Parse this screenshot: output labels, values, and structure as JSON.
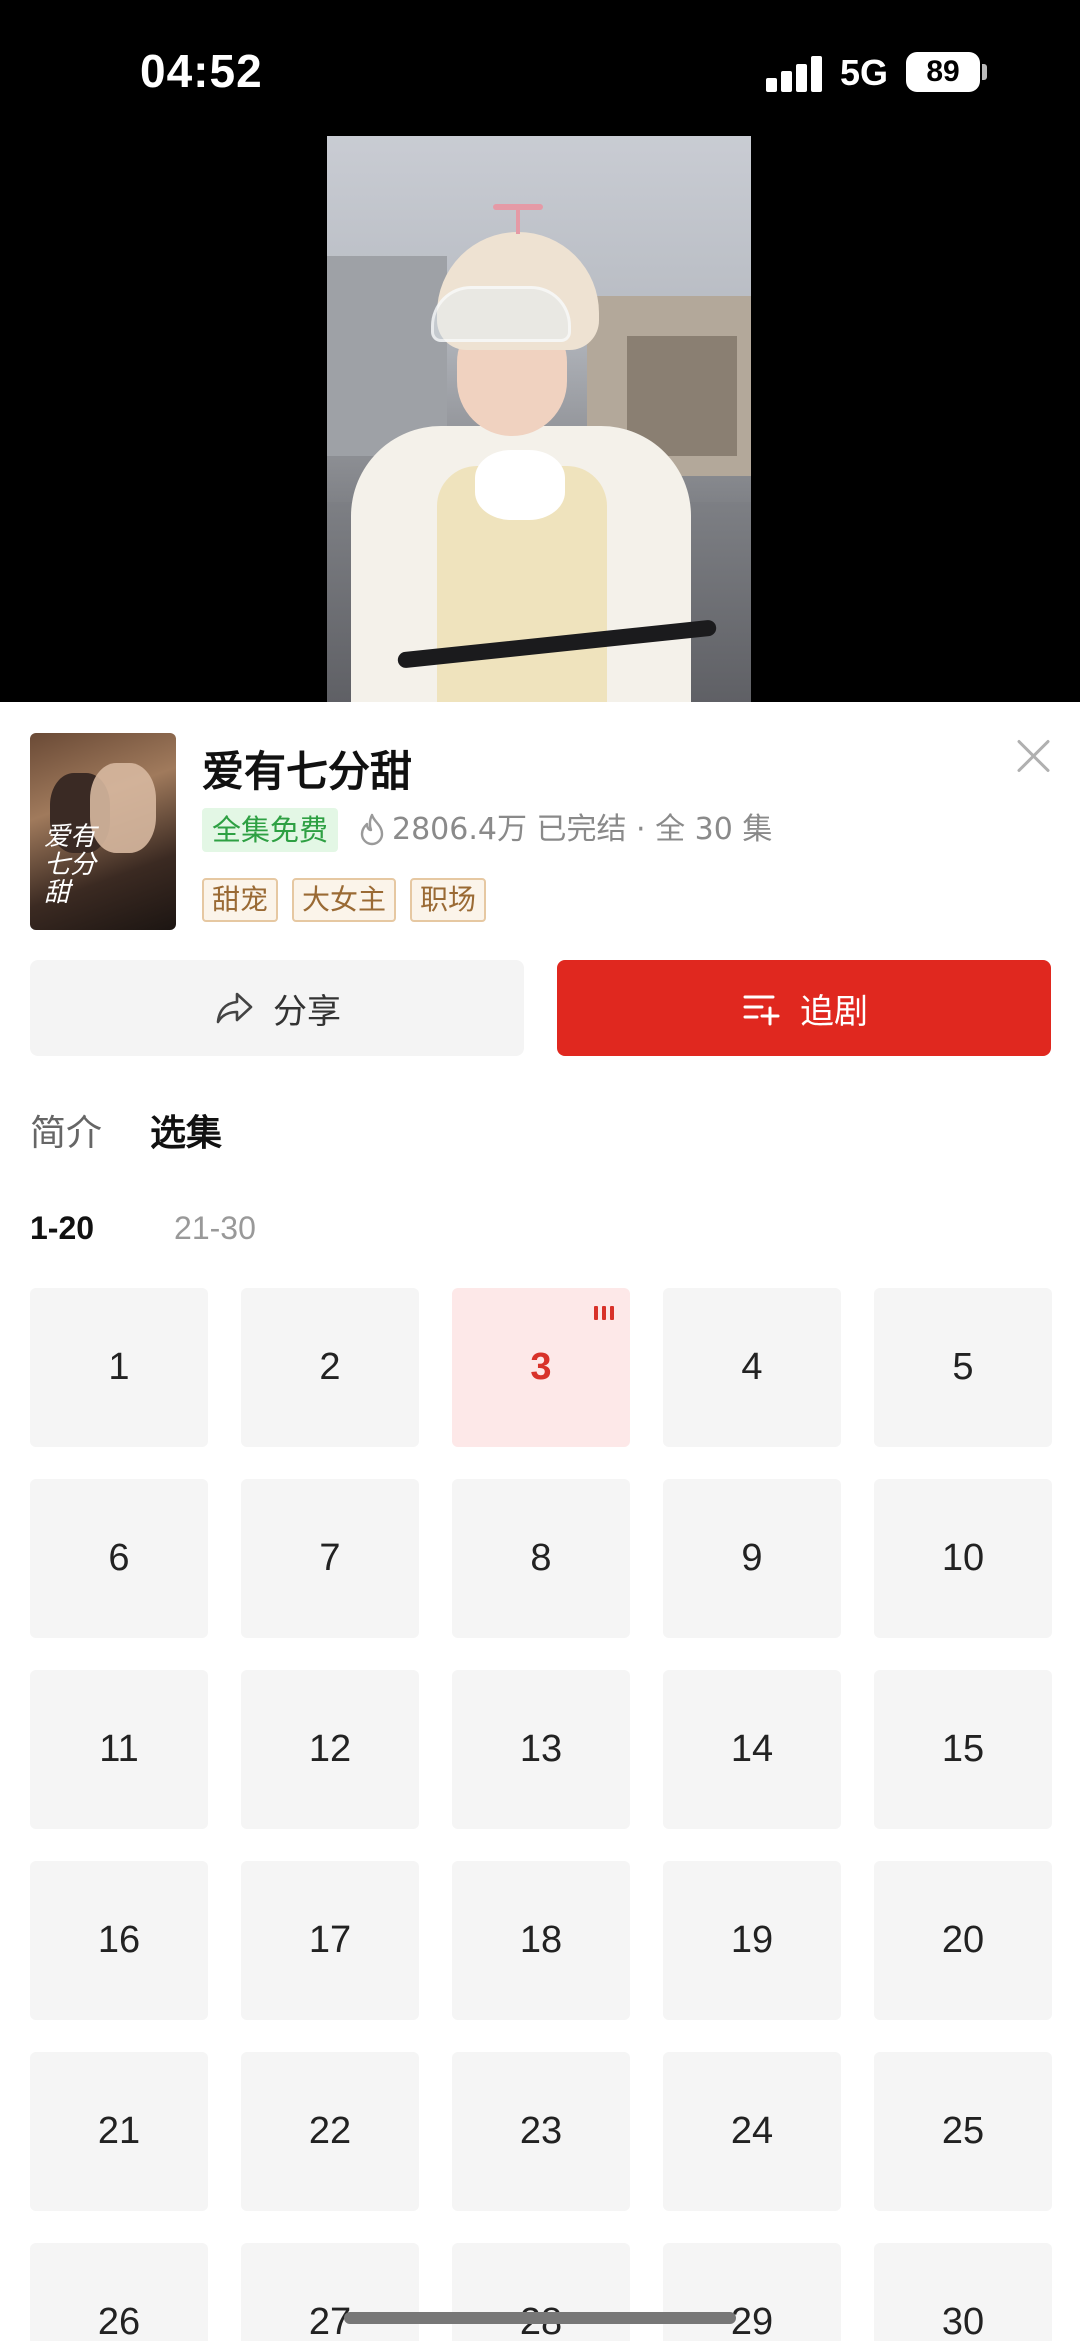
{
  "status_bar": {
    "time": "04:52",
    "network": "5G",
    "battery": "89"
  },
  "drama": {
    "title": "爱有七分甜",
    "poster_text": "爱有七分甜",
    "free_badge": "全集免费",
    "meta": "2806.4万 已完结 · 全 30 集",
    "tags": [
      "甜宠",
      "大女主",
      "职场"
    ]
  },
  "actions": {
    "share_label": "分享",
    "follow_label": "追剧"
  },
  "tabs": [
    {
      "label": "简介",
      "active": false
    },
    {
      "label": "选集",
      "active": true
    }
  ],
  "ranges": [
    {
      "label": "1-20",
      "active": true
    },
    {
      "label": "21-30",
      "active": false
    }
  ],
  "episodes": [
    "1",
    "2",
    "3",
    "4",
    "5",
    "6",
    "7",
    "8",
    "9",
    "10",
    "11",
    "12",
    "13",
    "14",
    "15",
    "16",
    "17",
    "18",
    "19",
    "20",
    "21",
    "22",
    "23",
    "24",
    "25",
    "26",
    "27",
    "28",
    "29",
    "30"
  ],
  "current_episode": "3",
  "colors": {
    "accent": "#e0281f",
    "free_green": "#2ea043",
    "tag_brown": "#9a6a34"
  },
  "icons": {
    "share": "share-arrow-icon",
    "follow": "add-to-list-icon",
    "close": "close-icon",
    "hot": "fire-icon",
    "playing": "playing-bars-icon"
  }
}
